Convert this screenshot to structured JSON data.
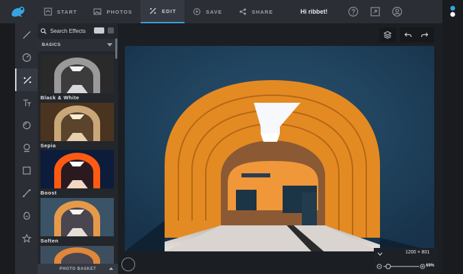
{
  "app": {
    "greeting": "Hi ribbet!"
  },
  "nav": {
    "tabs": [
      {
        "label": "START",
        "icon": "home-icon"
      },
      {
        "label": "PHOTOS",
        "icon": "image-icon"
      },
      {
        "label": "EDIT",
        "icon": "magic-wand-icon",
        "active": true
      },
      {
        "label": "SAVE",
        "icon": "save-icon"
      },
      {
        "label": "SHARE",
        "icon": "share-icon"
      }
    ]
  },
  "rail": {
    "tools": [
      "brush-icon",
      "dial-icon",
      "effects-icon",
      "text-icon",
      "touchup-icon",
      "stamp-icon",
      "frame-icon",
      "curve-icon",
      "sticker-icon",
      "star-icon"
    ],
    "active_index": 2
  },
  "effects_panel": {
    "search_placeholder": "Search Effects",
    "section": "BASICS",
    "effects": [
      {
        "name": "Black & White"
      },
      {
        "name": "Sepia"
      },
      {
        "name": "Boost"
      },
      {
        "name": "Soften"
      },
      {
        "name": ""
      }
    ],
    "basket_label": "PHOTO BASKET"
  },
  "canvas": {
    "dimensions": "1200 × 801",
    "zoom": "69%",
    "zoom_level": 0.69
  },
  "colors": {
    "accent": "#38a3e0",
    "tunnel_orange": "#e48a22",
    "background": "#1f2227"
  }
}
